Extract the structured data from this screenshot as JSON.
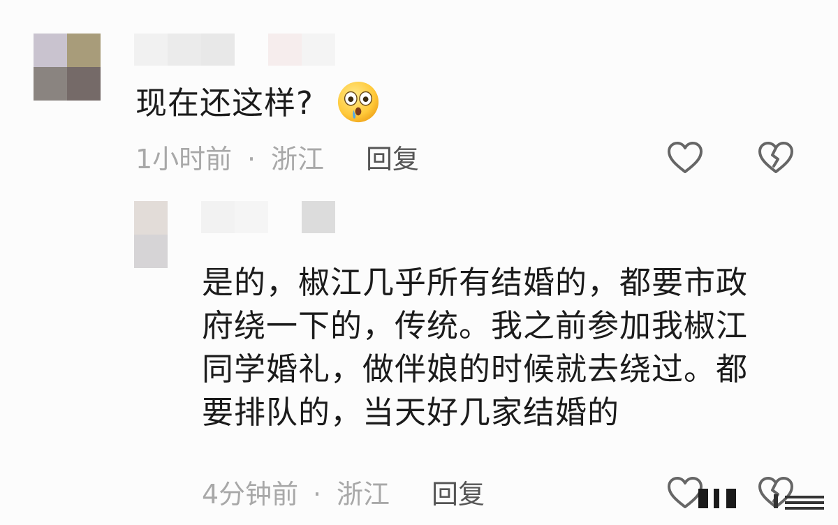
{
  "comments": [
    {
      "text": "现在还这样?",
      "emoji": "astonished-face-icon",
      "time": "1小时前",
      "separator": "·",
      "location": "浙江",
      "reply_label": "回复"
    },
    {
      "text": "是的，椒江几乎所有结婚的，都要市政府绕一下的，传统。我之前参加我椒江同学婚礼，做伴娘的时候就去绕过。都要排队的，当天好几家结婚的",
      "lines": [
        "是的，椒江几乎所有结婚的，都要市政",
        "府绕一下的，传统。我之前参加我椒江",
        "同学婚礼，做伴娘的时候就去绕过。都",
        "要排队的，当天好几家结婚的"
      ],
      "time": "4分钟前",
      "separator": "·",
      "location": "浙江",
      "reply_label": "回复"
    }
  ],
  "icons": {
    "like": "heart-outline-icon",
    "dislike": "broken-heart-icon",
    "menu": "menu-lines-icon"
  },
  "colors": {
    "background": "#fcfcfc",
    "text": "#1b1b1b",
    "meta": "#a8a8a8",
    "reply": "#555555",
    "icon": "#666666"
  }
}
